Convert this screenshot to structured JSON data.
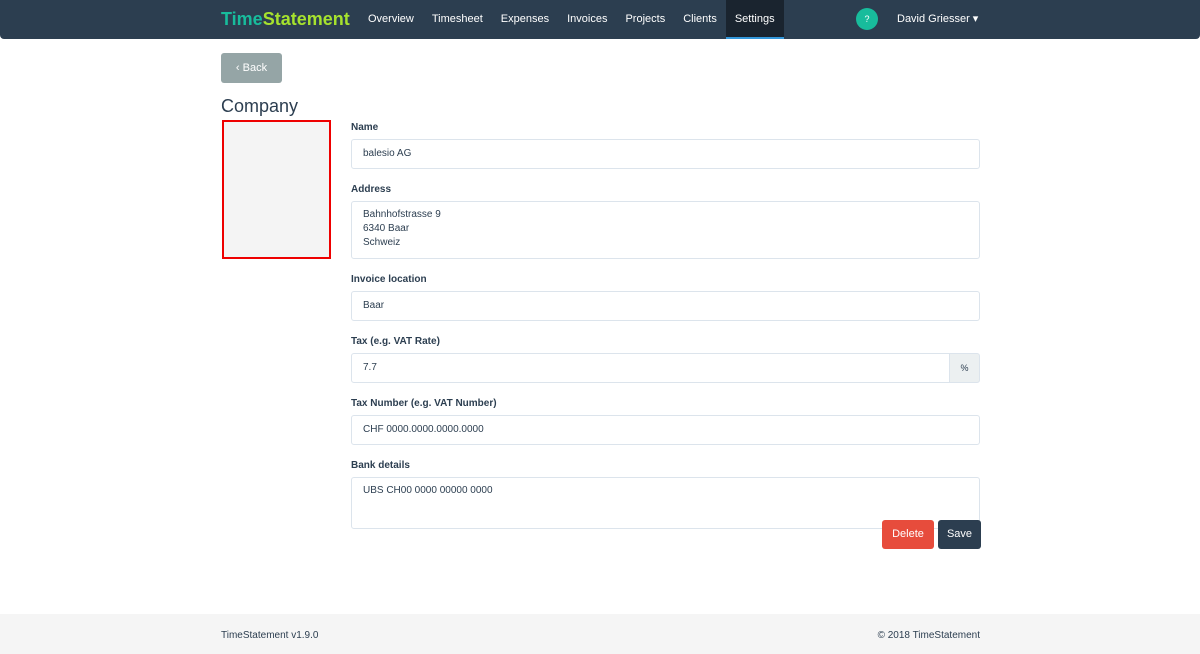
{
  "navbar": {
    "brand_a": "Time",
    "brand_b": "Statement",
    "items": [
      "Overview",
      "Timesheet",
      "Expenses",
      "Invoices",
      "Projects",
      "Clients",
      "Settings"
    ],
    "help": "?",
    "user": "David Griesser ▾"
  },
  "back": "‹  Back",
  "title": "Company",
  "form": {
    "name_label": "Name",
    "name": "balesio AG",
    "address_label": "Address",
    "address": "Bahnhofstrasse 9\n6340 Baar\nSchweiz",
    "invoice_location_label": "Invoice location",
    "invoice_location": "Baar",
    "tax_label": "Tax (e.g. VAT Rate)",
    "tax": "7.7",
    "tax_unit": "%",
    "tax_number_label": "Tax Number (e.g. VAT Number)",
    "tax_number": "CHF 0000.0000.0000.0000",
    "bank_label": "Bank details",
    "bank": "UBS CH00 0000 00000 0000"
  },
  "buttons": {
    "delete": "Delete",
    "save": "Save"
  },
  "footer": {
    "version": "TimeStatement v1.9.0",
    "copyright": "© 2018 TimeStatement"
  }
}
